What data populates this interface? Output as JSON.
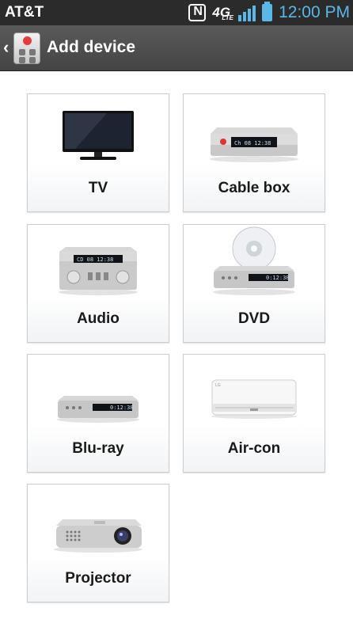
{
  "status_bar": {
    "carrier": "AT&T",
    "network": "4G",
    "network_sub": "LTE",
    "time": "12:00 PM"
  },
  "header": {
    "title": "Add device"
  },
  "devices": [
    {
      "label": "TV",
      "icon": "tv-icon"
    },
    {
      "label": "Cable box",
      "icon": "cable-box-icon",
      "display": "Ch 08 12:38"
    },
    {
      "label": "Audio",
      "icon": "audio-icon",
      "display": "CD 08 12:38"
    },
    {
      "label": "DVD",
      "icon": "dvd-icon",
      "display": "0:12:38"
    },
    {
      "label": "Blu-ray",
      "icon": "blu-ray-icon",
      "display": "0:12:38"
    },
    {
      "label": "Air-con",
      "icon": "air-con-icon"
    },
    {
      "label": "Projector",
      "icon": "projector-icon"
    }
  ],
  "colors": {
    "accent": "#5ab7e6",
    "status_bar": "#2b2b2b",
    "title_bar": "#4f4f4f"
  }
}
